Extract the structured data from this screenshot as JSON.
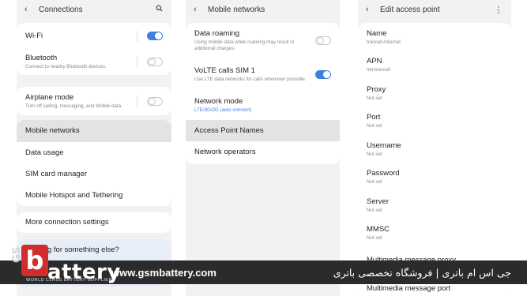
{
  "panel1": {
    "header": {
      "title": "Connections"
    },
    "wifi": {
      "label": "Wi-Fi",
      "toggle": "on"
    },
    "bluetooth": {
      "label": "Bluetooth",
      "sub": "Connect to nearby Bluetooth devices.",
      "toggle": "off"
    },
    "airplane": {
      "label": "Airplane mode",
      "sub": "Turn off calling, messaging, and Mobile data.",
      "toggle": "off"
    },
    "group": {
      "mobile_networks": "Mobile networks",
      "data_usage": "Data usage",
      "sim_manager": "SIM card manager",
      "hotspot": "Mobile Hotspot and Tethering"
    },
    "more": "More connection settings",
    "looking": "Looking for something else?"
  },
  "panel2": {
    "header": {
      "title": "Mobile networks"
    },
    "roaming": {
      "label": "Data roaming",
      "sub": "Using mobile data while roaming may result in additional charges.",
      "toggle": "off"
    },
    "volte": {
      "label": "VoLTE calls SIM 1",
      "sub": "Use LTE data networks for calls whenever possible.",
      "toggle": "on"
    },
    "network_mode": {
      "label": "Network mode",
      "value": "LTE/3G/2G (auto connect)"
    },
    "apn": "Access Point Names",
    "operators": "Network operators"
  },
  "panel3": {
    "header": {
      "title": "Edit access point"
    },
    "fields": [
      {
        "label": "Name",
        "value": "trancell-Internet"
      },
      {
        "label": "APN",
        "value": "mtnirancell"
      },
      {
        "label": "Proxy",
        "value": "Not set"
      },
      {
        "label": "Port",
        "value": "Not set"
      },
      {
        "label": "Username",
        "value": "Not set"
      },
      {
        "label": "Password",
        "value": "Not set"
      },
      {
        "label": "Server",
        "value": "Not set"
      },
      {
        "label": "MMSC",
        "value": "Not set"
      },
      {
        "label": "Multimedia message proxy",
        "value": ""
      },
      {
        "label": "Multimedia message port",
        "value": ""
      }
    ]
  },
  "banner": {
    "logo_gs": "GS",
    "logo_b": "b",
    "logo_word": "attery",
    "tagline": "WORLD CLASS BATTERY SUPPLIER",
    "url": "www.gsmbattery.com",
    "persian": "جی اس ام باتری | فروشگاه تخصصی باتری"
  },
  "colors": {
    "accent": "#3e7fe0",
    "banner": "#2b2b2b",
    "logo": "#d12d2d"
  }
}
